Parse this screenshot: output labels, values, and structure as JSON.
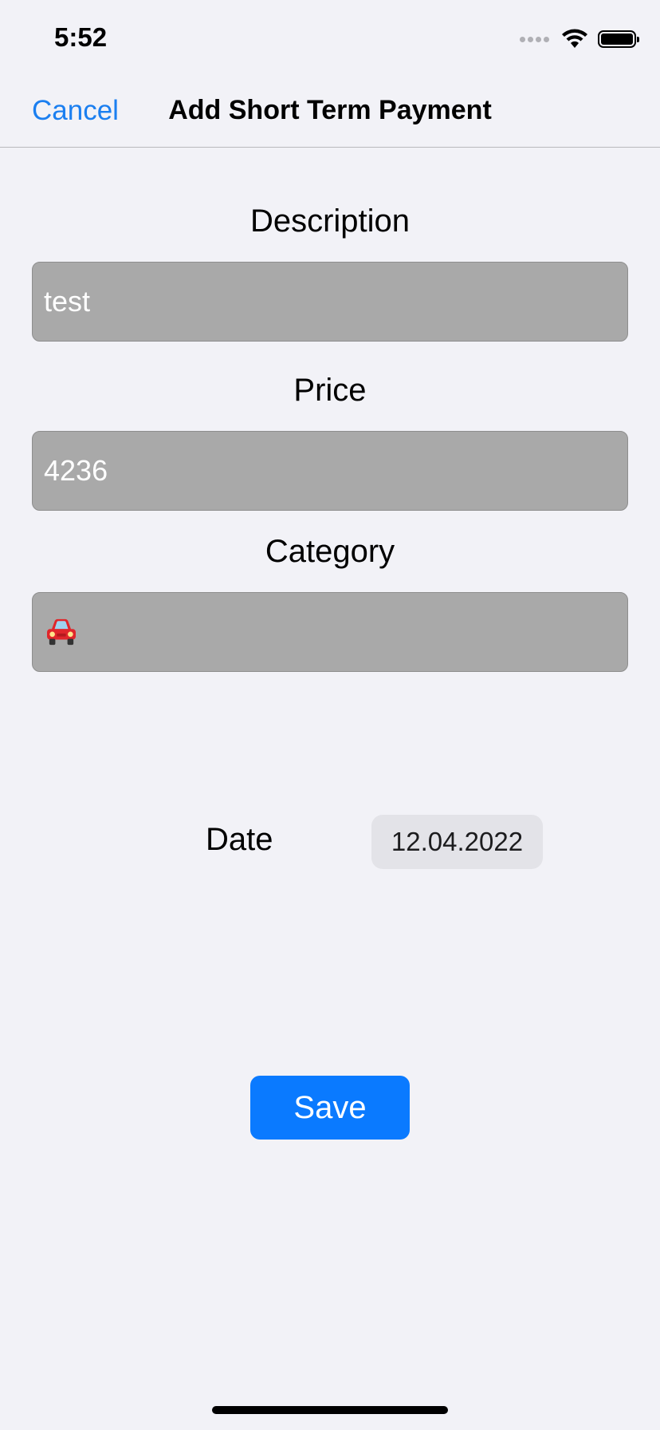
{
  "status_bar": {
    "time": "5:52",
    "icons": [
      "signal-dots-icon",
      "wifi-icon",
      "battery-icon"
    ]
  },
  "nav": {
    "cancel_label": "Cancel",
    "title": "Add Short Term Payment"
  },
  "form": {
    "description_label": "Description",
    "description_value": "test",
    "price_label": "Price",
    "price_value": "4236",
    "category_label": "Category",
    "category_icon": "car-icon",
    "date_label": "Date",
    "date_value": "12.04.2022"
  },
  "actions": {
    "save_label": "Save"
  },
  "colors": {
    "background": "#f2f2f7",
    "accent": "#0a7aff",
    "field_fill": "#a9a9a9",
    "field_text": "#ffffff",
    "date_pill": "#e3e3e8"
  }
}
